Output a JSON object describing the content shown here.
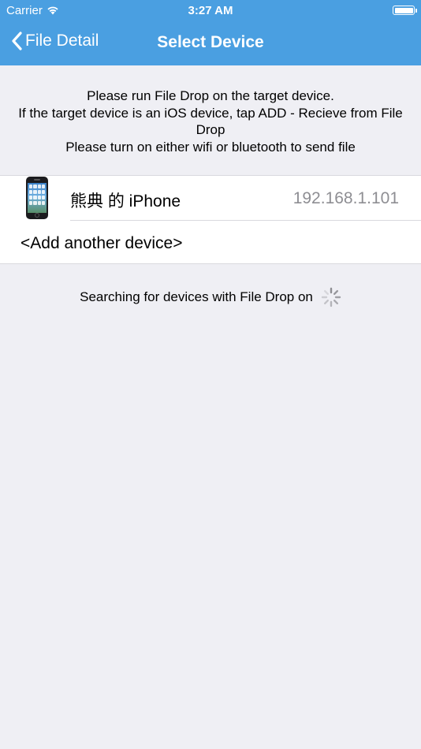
{
  "status_bar": {
    "carrier": "Carrier",
    "time": "3:27 AM",
    "wifi_icon": "wifi-icon",
    "battery_icon": "battery-icon"
  },
  "nav": {
    "back_label": "File Detail",
    "back_icon": "chevron-left-icon",
    "title": "Select Device",
    "bar_color": "#4a9fe1"
  },
  "instructions": {
    "line1": "Please run File Drop on the target device.",
    "line2": "If the target device is an iOS device, tap ADD - Recieve from File Drop",
    "line3": "Please turn on either wifi or bluetooth to send file"
  },
  "devices": [
    {
      "name": "熊典 的 iPhone",
      "ip": "192.168.1.101",
      "icon": "iphone-icon"
    }
  ],
  "add_device": {
    "label": "<Add another device>"
  },
  "searching": {
    "label": "Searching for devices with File Drop on",
    "icon": "spinner-icon"
  }
}
